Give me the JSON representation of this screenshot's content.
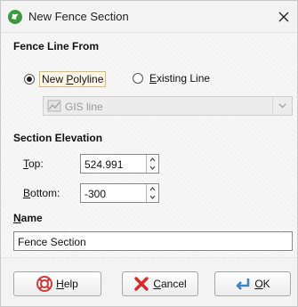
{
  "window": {
    "title": "New Fence Section",
    "close_icon": "close-icon",
    "app_icon": "leapfrog-icon"
  },
  "fence_line_from": {
    "heading": "Fence Line From",
    "options": [
      {
        "label_pre": "New ",
        "label_u": "P",
        "label_post": "olyline",
        "selected": true
      },
      {
        "label_pre": "",
        "label_u": "E",
        "label_post": "xisting Line",
        "selected": false
      }
    ],
    "line_select": {
      "value": "GIS line",
      "enabled": false,
      "icon": "gis-line-icon"
    }
  },
  "section_elevation": {
    "heading": "Section Elevation",
    "top": {
      "label_u": "T",
      "label_post": "op:",
      "value": "524.991"
    },
    "bottom": {
      "label_u": "B",
      "label_post": "ottom:",
      "value": "-300"
    }
  },
  "name": {
    "heading_u": "N",
    "heading_post": "ame",
    "value": "Fence Section"
  },
  "buttons": {
    "help": {
      "label_u": "H",
      "label_post": "elp",
      "icon": "help-icon"
    },
    "cancel": {
      "label_u": "C",
      "label_post": "ancel",
      "icon": "cancel-icon"
    },
    "ok": {
      "label_u": "O",
      "label_post": "K",
      "icon": "ok-icon"
    }
  },
  "colors": {
    "accent_focus": "#e8b36b",
    "app_icon": "#3b9a3e"
  }
}
